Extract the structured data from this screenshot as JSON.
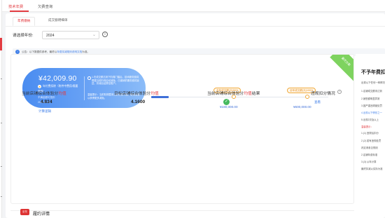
{
  "header": {
    "tabs": [
      {
        "label": "技术年费",
        "active": true
      },
      {
        "label": "欠费查询",
        "active": false
      }
    ]
  },
  "subtabs": [
    {
      "label": "年费缴纳",
      "active": true
    },
    {
      "label": "成交额明细单",
      "active": false
    }
  ],
  "filter": {
    "year_label": "请选择年份:",
    "year_value": "2024"
  },
  "notice": {
    "prefix": "公告：以下数据供参考，最终以",
    "link": "年费扣减规则说明文档",
    "suffix": "为准。"
  },
  "fee_card": {
    "amount": "¥42,009.90",
    "line1": "年付费扣除（附件中费用/需要",
    "line2": "缴纳)",
    "line3": "不满金额可抵扣",
    "line4": "2024.09.28",
    "tip": "1.在成交额达到下阶梯门槛后，技术服务费将根据当前阶梯自动减免，已缴纳的服务费将返还，扣减后结算至账户。",
    "tip2": "温馨提示：当前阶梯暂未达到优惠门槛，继续经营以获得更多减免。"
  },
  "badge": {
    "label": "最优方案"
  },
  "progress": {
    "fill_fraction": 0.1,
    "markers": [
      {
        "label": "全年成交额(元)50%",
        "value": "¥180,000.00"
      },
      {
        "label": "全年成交额(元)100%",
        "value": "¥600,000.00"
      }
    ]
  },
  "metrics": [
    {
      "title_pre": "当前店铺综合体验分",
      "title_hl": "均值",
      "title_post": "",
      "value": "4.834",
      "link": "计算逻辑"
    },
    {
      "title_pre": "目标店铺综合体验分",
      "title_hl": "均值",
      "title_post": "",
      "value": "4.1600",
      "link": ""
    },
    {
      "title_pre": "当前店铺综合体验分",
      "title_hl": "均值",
      "title_post": "结果",
      "value": "",
      "link": ""
    },
    {
      "title_pre": "违规扣分情况",
      "title_hl": "",
      "title_post": "",
      "value": "",
      "link": "查看"
    }
  ],
  "rules": {
    "title": "不予年费扣减",
    "items": [
      {
        "text": "出现以下任何一种情况",
        "tone": "normal"
      },
      {
        "text": "1.店铺成交额未达到",
        "tone": "normal"
      },
      {
        "text": "2.销售额明显异常",
        "tone": "normal"
      },
      {
        "text": "3.因严重违规被处罚",
        "tone": "normal"
      },
      {
        "text": "4.出现以下情形之一",
        "tone": "blue"
      },
      {
        "text": "5.出现2次及以上",
        "tone": "normal"
      },
      {
        "text": "温馨提示：",
        "tone": "red"
      },
      {
        "text": "1.(1) 违规后扣分",
        "tone": "normal"
      },
      {
        "text": "2.(2) 若有违规处罚",
        "tone": "normal"
      },
      {
        "text": "判定请参见规则",
        "tone": "normal"
      },
      {
        "text": "2.店铺年费标准",
        "tone": "normal"
      },
      {
        "text": "3.(3) 以年计算",
        "tone": "normal"
      },
      {
        "text": "最终扣减以实际为准",
        "tone": "normal"
      }
    ]
  },
  "section": {
    "icon_label": "京东",
    "title": "履约详情"
  },
  "colors": {
    "brand_red": "#e23b40",
    "primary_blue": "#3e7ee8",
    "badge_green": "#7ed35f",
    "marker_orange": "#f0a93a"
  }
}
